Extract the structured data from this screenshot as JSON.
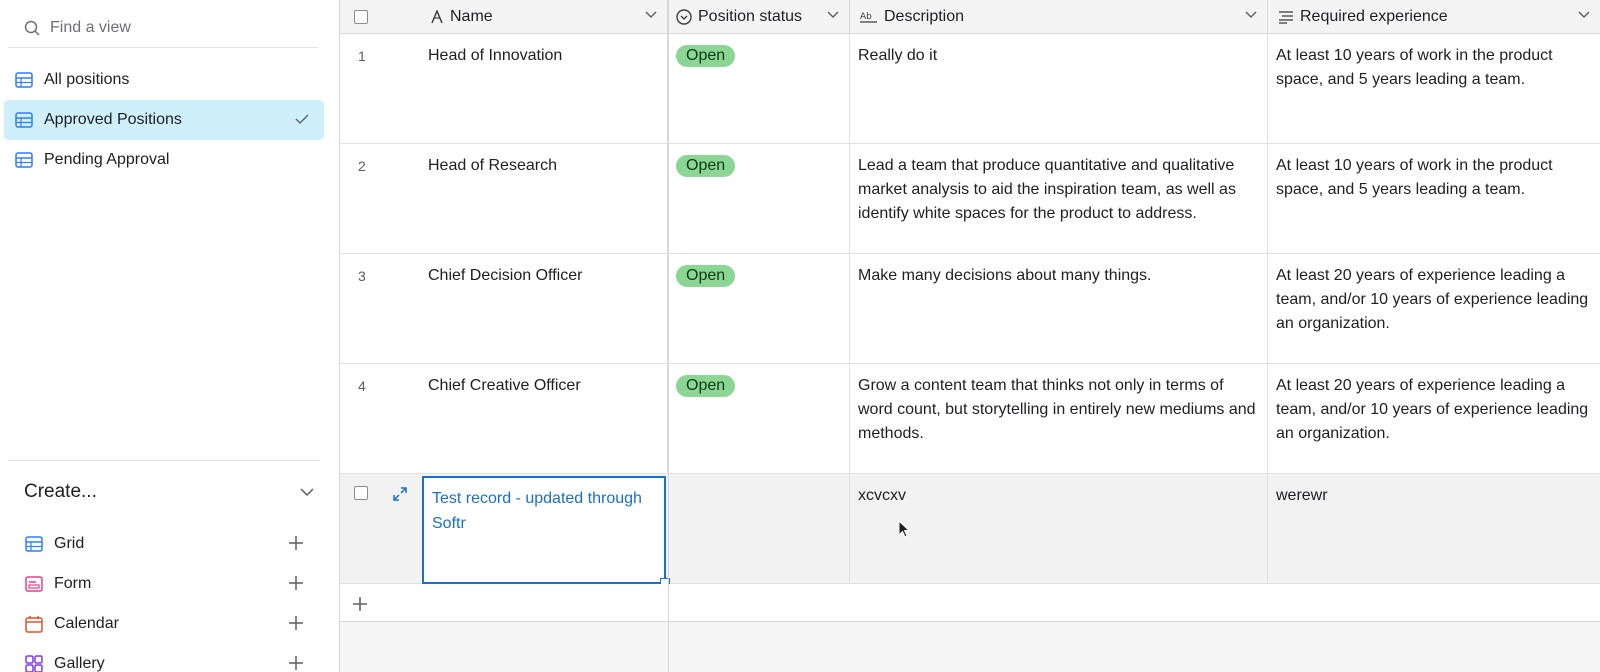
{
  "sidebar": {
    "search_placeholder": "Find a view",
    "views": [
      {
        "label": "All positions"
      },
      {
        "label": "Approved Positions",
        "active": true
      },
      {
        "label": "Pending Approval"
      }
    ],
    "create": {
      "title": "Create...",
      "items": [
        {
          "label": "Grid",
          "icon": "grid-icon",
          "color": "#2d7ff9"
        },
        {
          "label": "Form",
          "icon": "form-icon",
          "color": "#e0408f"
        },
        {
          "label": "Calendar",
          "icon": "calendar-icon",
          "color": "#e0522d"
        },
        {
          "label": "Gallery",
          "icon": "gallery-icon",
          "color": "#7c3aed"
        }
      ]
    }
  },
  "grid": {
    "columns": [
      {
        "label": "Name",
        "icon": "text-icon"
      },
      {
        "label": "Position status",
        "icon": "status-icon"
      },
      {
        "label": "Description",
        "icon": "long-text-icon"
      },
      {
        "label": "Required experience",
        "icon": "paragraph-icon"
      }
    ],
    "rows": [
      {
        "num": "1",
        "name": "Head of Innovation",
        "status": "Open",
        "description": "Really do it",
        "experience": "At least 10 years of work in the product space, and 5 years leading a team."
      },
      {
        "num": "2",
        "name": "Head of Research",
        "status": "Open",
        "description": "Lead a team that produce quantitative and qualitative market analysis to aid the inspiration team, as well as identify white spaces for the product to address.",
        "experience": "At least 10 years of work in the product space, and 5 years leading a team."
      },
      {
        "num": "3",
        "name": "Chief Decision Officer",
        "status": "Open",
        "description": "Make many decisions about many things.",
        "experience": "At least 20 years of experience leading a team, and/or 10 years of experience leading an organization."
      },
      {
        "num": "4",
        "name": "Chief Creative Officer",
        "status": "Open",
        "description": "Grow a content team that thinks not only in terms of word count, but storytelling in entirely new mediums and methods.",
        "experience": "At least 20 years of experience leading a team, and/or 10 years of experience leading an organization."
      }
    ],
    "selected_row": {
      "name": "Test record - updated through Softr",
      "description": "xcvcxv",
      "experience": "werewr"
    }
  },
  "colors": {
    "accent": "#1a6fc8",
    "active_view_bg": "#cff0fb",
    "status_open": "#8bd695"
  }
}
